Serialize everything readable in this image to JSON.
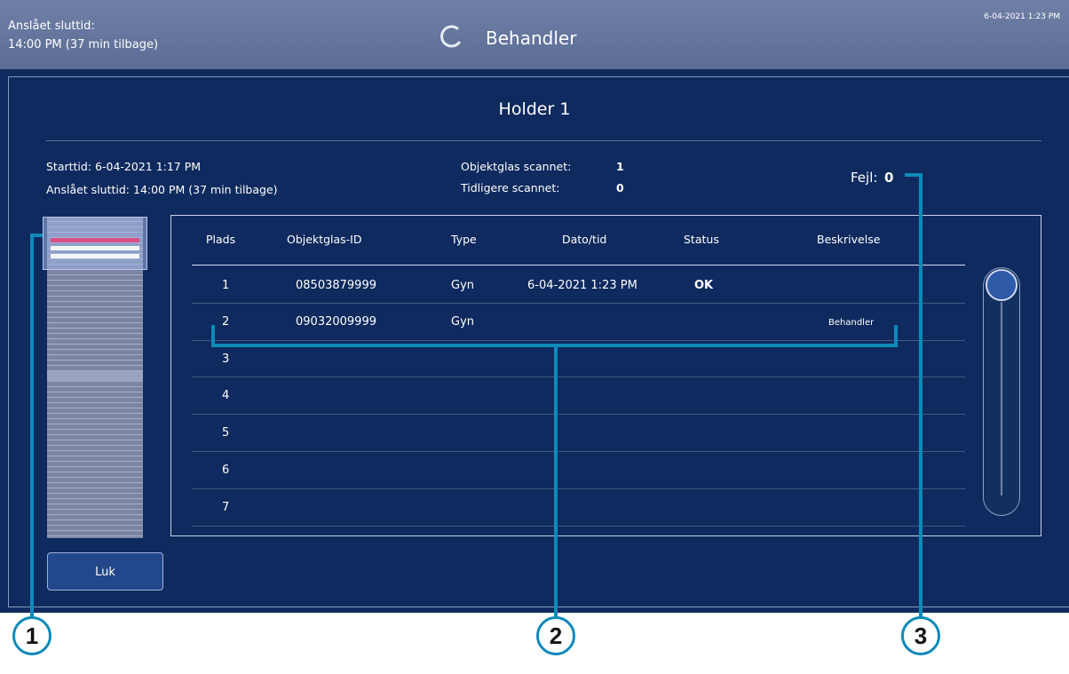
{
  "topbar": {
    "left_line1": "Anslået sluttid:",
    "left_line2": "14:00 PM (37 min tilbage)",
    "title": "Behandler",
    "datetime": "6-04-2021 1:23 PM",
    "spinner_icon": "loading-spinner-icon"
  },
  "holder": {
    "title": "Holder 1",
    "start_label": "Starttid: 6-04-2021 1:17 PM",
    "end_label": "Anslået sluttid: 14:00 PM (37 min tilbage)",
    "scanned_label": "Objektglas scannet:",
    "scanned_value": "1",
    "prev_label": "Tidligere scannet:",
    "prev_value": "0",
    "errors_label": "Fejl:",
    "errors_value": "0"
  },
  "table": {
    "headers": [
      "Plads",
      "Objektglas-ID",
      "Type",
      "Dato/tid",
      "Status",
      "Beskrivelse"
    ],
    "rows": [
      {
        "plads": "1",
        "id": "08503879999",
        "type": "Gyn",
        "date": "6-04-2021 1:23 PM",
        "status": "OK",
        "desc": ""
      },
      {
        "plads": "2",
        "id": "09032009999",
        "type": "Gyn",
        "date": "",
        "status": "",
        "desc": "Behandler"
      },
      {
        "plads": "3",
        "id": "",
        "type": "",
        "date": "",
        "status": "",
        "desc": ""
      },
      {
        "plads": "4",
        "id": "",
        "type": "",
        "date": "",
        "status": "",
        "desc": ""
      },
      {
        "plads": "5",
        "id": "",
        "type": "",
        "date": "",
        "status": "",
        "desc": ""
      },
      {
        "plads": "6",
        "id": "",
        "type": "",
        "date": "",
        "status": "",
        "desc": ""
      },
      {
        "plads": "7",
        "id": "",
        "type": "",
        "date": "",
        "status": "",
        "desc": ""
      }
    ]
  },
  "buttons": {
    "close_label": "Luk"
  },
  "callouts": [
    "1",
    "2",
    "3"
  ],
  "colors": {
    "background": "#0f2a5e",
    "topbar": "#6f7fa6",
    "accent": "#0e8ab8",
    "slot_highlight": "#d94f86"
  }
}
